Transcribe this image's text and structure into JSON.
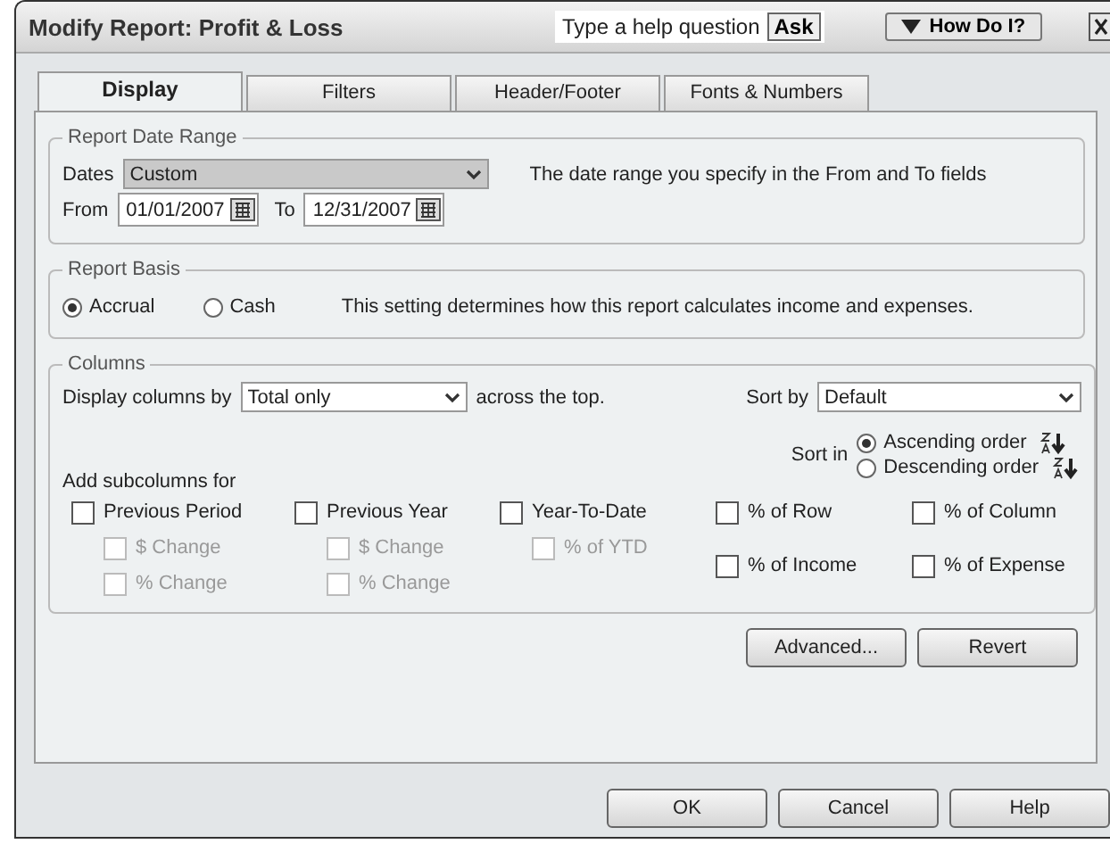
{
  "window": {
    "title": "Modify Report: Profit & Loss",
    "help_placeholder": "Type a help question",
    "ask_button": "Ask",
    "how_do_i_button": "How Do I?"
  },
  "tabs": [
    {
      "label": "Display",
      "selected": true
    },
    {
      "label": "Filters",
      "selected": false
    },
    {
      "label": "Header/Footer",
      "selected": false
    },
    {
      "label": "Fonts & Numbers",
      "selected": false
    }
  ],
  "date_range": {
    "group_label": "Report Date Range",
    "dates_label": "Dates",
    "dates_value": "Custom",
    "hint": "The date range you specify in the From and To fields",
    "from_label": "From",
    "from_value": "01/01/2007",
    "to_label": "To",
    "to_value": "12/31/2007"
  },
  "report_basis": {
    "group_label": "Report Basis",
    "options": [
      {
        "label": "Accrual",
        "selected": true
      },
      {
        "label": "Cash",
        "selected": false
      }
    ],
    "hint": "This setting determines how this report calculates income and expenses."
  },
  "columns": {
    "group_label": "Columns",
    "display_by_label": "Display columns by",
    "display_by_value": "Total only",
    "across_label": "across the top.",
    "sort_by_label": "Sort by",
    "sort_by_value": "Default",
    "sort_in_label": "Sort in",
    "sort_orders": [
      {
        "label": "Ascending order",
        "selected": true
      },
      {
        "label": "Descending order",
        "selected": false
      }
    ],
    "subcolumns_label": "Add subcolumns for",
    "subcolumns": [
      {
        "label": "Previous Period",
        "checked": false,
        "disabled": false,
        "children": [
          {
            "label": "$ Change",
            "checked": false,
            "disabled": true
          },
          {
            "label": "% Change",
            "checked": false,
            "disabled": true
          }
        ]
      },
      {
        "label": "Previous Year",
        "checked": false,
        "disabled": false,
        "children": [
          {
            "label": "$ Change",
            "checked": false,
            "disabled": true
          },
          {
            "label": "% Change",
            "checked": false,
            "disabled": true
          }
        ]
      },
      {
        "label": "Year-To-Date",
        "checked": false,
        "disabled": false,
        "children": [
          {
            "label": "% of YTD",
            "checked": false,
            "disabled": true
          }
        ]
      }
    ],
    "percents": [
      {
        "label": "% of Row",
        "checked": false
      },
      {
        "label": "% of Column",
        "checked": false
      },
      {
        "label": "% of Income",
        "checked": false
      },
      {
        "label": "% of Expense",
        "checked": false
      }
    ]
  },
  "panel_buttons": [
    "Advanced...",
    "Revert"
  ],
  "footer_buttons": [
    "OK",
    "Cancel",
    "Help"
  ]
}
